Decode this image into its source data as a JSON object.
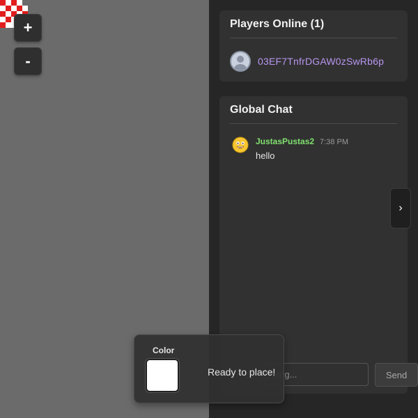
{
  "canvas": {
    "zoom_in_label": "+",
    "zoom_out_label": "-",
    "background_color": "#6b6b6b"
  },
  "players_online": {
    "title": "Players Online (1)",
    "players": [
      {
        "name": "03EF7TnfrDGAW0zSwRb6p",
        "avatar_icon": "default-user-avatar-icon"
      }
    ],
    "name_color": "#b896f0"
  },
  "chat": {
    "title": "Global Chat",
    "messages": [
      {
        "user": "JustasPustas2",
        "time": "7:38 PM",
        "text": "hello",
        "avatar_icon": "smiley-avatar-icon"
      }
    ],
    "input_placeholder": "ning...",
    "send_label": "Send",
    "toggle_label": "›",
    "username_color": "#7fe06e"
  },
  "color_picker": {
    "label": "Color",
    "selected_color": "#ffffff",
    "status": "Ready to place!"
  }
}
